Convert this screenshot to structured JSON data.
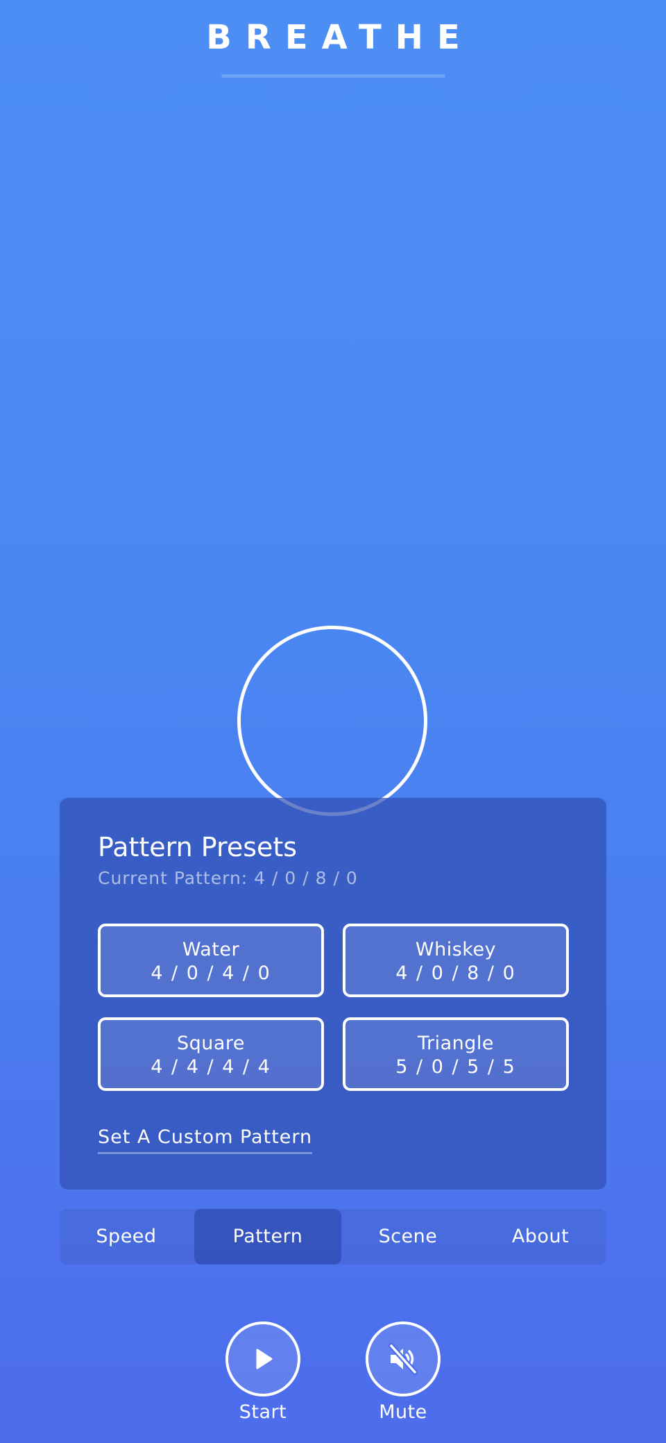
{
  "header": {
    "app_title": "BREATHE"
  },
  "panel": {
    "title": "Pattern Presets",
    "current_pattern": "Current Pattern: 4 / 0 / 8 / 0",
    "presets": [
      {
        "name": "Water",
        "values": "4 / 0 / 4 / 0"
      },
      {
        "name": "Whiskey",
        "values": "4 / 0 / 8 / 0"
      },
      {
        "name": "Square",
        "values": "4 / 4 / 4 / 4"
      },
      {
        "name": "Triangle",
        "values": "5 / 0 / 5 / 5"
      }
    ],
    "custom_link": "Set A Custom Pattern"
  },
  "tabs": [
    {
      "label": "Speed",
      "active": false
    },
    {
      "label": "Pattern",
      "active": true
    },
    {
      "label": "Scene",
      "active": false
    },
    {
      "label": "About",
      "active": false
    }
  ],
  "controls": {
    "start": {
      "label": "Start",
      "icon": "play-icon"
    },
    "mute": {
      "label": "Mute",
      "icon": "volume-muted-icon"
    }
  },
  "colors": {
    "background_top": "#4d8ef5",
    "background_bottom": "#4d6cec",
    "panel": "#3250b4",
    "text": "#ffffff"
  }
}
